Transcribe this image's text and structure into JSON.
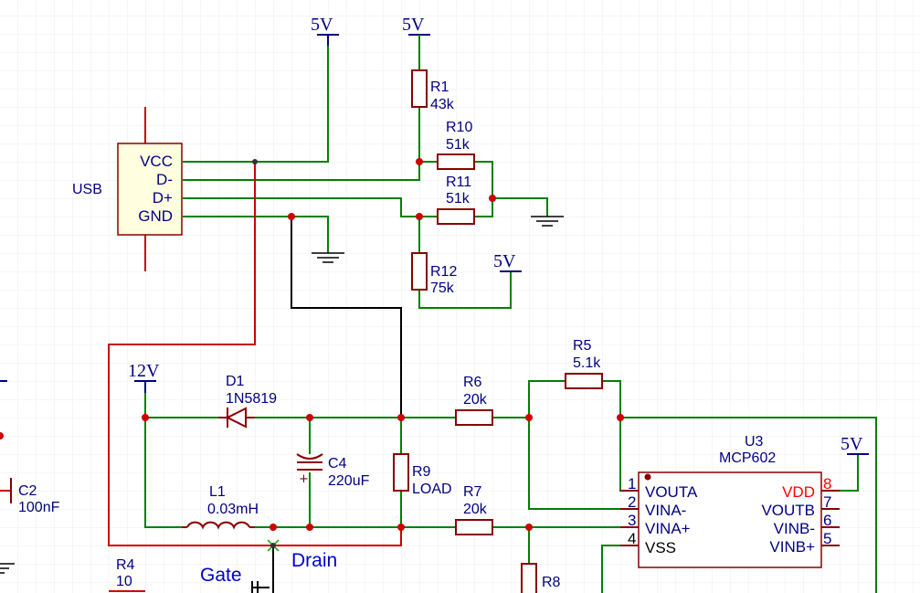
{
  "usb": {
    "name": "USB",
    "pins": [
      "VCC",
      "D-",
      "D+",
      "GND"
    ]
  },
  "power": {
    "v5": "5V",
    "v12": "12V"
  },
  "resistors": {
    "r1": {
      "name": "R1",
      "value": "43k"
    },
    "r10": {
      "name": "R10",
      "value": "51k"
    },
    "r11": {
      "name": "R11",
      "value": "51k"
    },
    "r12": {
      "name": "R12",
      "value": "75k"
    },
    "r5": {
      "name": "R5",
      "value": "5.1k"
    },
    "r6": {
      "name": "R6",
      "value": "20k"
    },
    "r7": {
      "name": "R7",
      "value": "20k"
    },
    "r9": {
      "name": "R9",
      "value": "LOAD"
    },
    "r4": {
      "name": "R4",
      "value": "10"
    },
    "r8": {
      "name": "R8"
    }
  },
  "diode": {
    "name": "D1",
    "value": "1N5819"
  },
  "capacitors": {
    "c4": {
      "name": "C4",
      "value": "220uF"
    },
    "c2": {
      "name": "C2",
      "value": "100nF"
    }
  },
  "inductor": {
    "name": "L1",
    "value": "0.03mH"
  },
  "opamp": {
    "name": "U3",
    "value": "MCP602",
    "pins_left": [
      {
        "num": "1",
        "label": "VOUTA"
      },
      {
        "num": "2",
        "label": "VINA-"
      },
      {
        "num": "3",
        "label": "VINA+"
      },
      {
        "num": "4",
        "label": "VSS"
      }
    ],
    "pins_right": [
      {
        "num": "8",
        "label": "VDD"
      },
      {
        "num": "7",
        "label": "VOUTB"
      },
      {
        "num": "6",
        "label": "VINB-"
      },
      {
        "num": "5",
        "label": "VINB+"
      }
    ]
  },
  "nets": {
    "gate": "Gate",
    "drain": "Drain"
  },
  "colors": {
    "wire": "#008000",
    "body": "#880000",
    "fill": "#ffffe0",
    "junction": "#cc0000",
    "label": "#000080",
    "vdd": "#ff0000"
  }
}
